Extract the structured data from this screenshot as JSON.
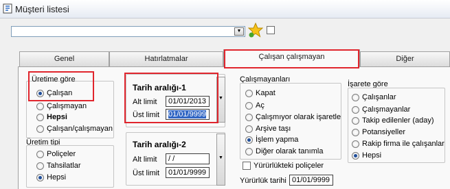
{
  "window": {
    "title": "Müşteri listesi",
    "icon": "app-icon"
  },
  "toolbar": {
    "combo_value": "",
    "star_icon": "favorites-star-icon",
    "checkbox_checked": false
  },
  "tabs": [
    {
      "label": "Genel",
      "active": false
    },
    {
      "label": "Hatırlatmalar",
      "active": false
    },
    {
      "label": "Çalışan çalışmayan",
      "active": true
    },
    {
      "label": "Diğer",
      "active": false
    }
  ],
  "uretime_gore": {
    "title": "Üretime göre",
    "options": [
      {
        "label": "Çalışan",
        "checked": true,
        "bold": false
      },
      {
        "label": "Çalışmayan",
        "checked": false,
        "bold": false
      },
      {
        "label": "Hepsi",
        "checked": false,
        "bold": true
      },
      {
        "label": "Çalışan/çalışmayan",
        "checked": false,
        "bold": false
      }
    ]
  },
  "uretim_tipi": {
    "title": "Üretim tipi",
    "options": [
      {
        "label": "Poliçeler",
        "checked": false
      },
      {
        "label": "Tahsilatlar",
        "checked": false
      },
      {
        "label": "Hepsi",
        "checked": true
      }
    ]
  },
  "tarih1": {
    "title": "Tarih aralığı-1",
    "alt_label": "Alt limit",
    "alt_value": "01/01/2013",
    "ust_label": "Üst limit",
    "ust_value": "01/01/9999"
  },
  "tarih2": {
    "title": "Tarih aralığı-2",
    "alt_label": "Alt limit",
    "alt_value": " / /",
    "ust_label": "Üst limit",
    "ust_value": "01/01/9999"
  },
  "calismayanlari": {
    "title": "Çalışmayanları",
    "options": [
      {
        "label": "Kapat",
        "checked": false
      },
      {
        "label": "Aç",
        "checked": false
      },
      {
        "label": "Çalışmıyor olarak işaretle",
        "checked": false
      },
      {
        "label": "Arşive taşı",
        "checked": false
      },
      {
        "label": "İşlem yapma",
        "checked": true
      },
      {
        "label": "Diğer olarak tanımla",
        "checked": false
      }
    ]
  },
  "yururluk": {
    "checkbox_label": "Yürürlükteki poliçeler",
    "date_label": "Yürürlük tarihi",
    "date_value": "01/01/9999"
  },
  "isarete_gore": {
    "title": "İşarete göre",
    "options": [
      {
        "label": "Çalışanlar",
        "checked": false
      },
      {
        "label": "Çalışmayanlar",
        "checked": false
      },
      {
        "label": "Takip edilenler (aday)",
        "checked": false
      },
      {
        "label": "Potansiyeller",
        "checked": false
      },
      {
        "label": "Rakip firma ile çalışanlar",
        "checked": false
      },
      {
        "label": "Hepsi",
        "checked": true
      }
    ]
  },
  "colors": {
    "highlight": "#e0242c",
    "selection": "#3166c4",
    "radio_dot": "#1f4e9a"
  }
}
